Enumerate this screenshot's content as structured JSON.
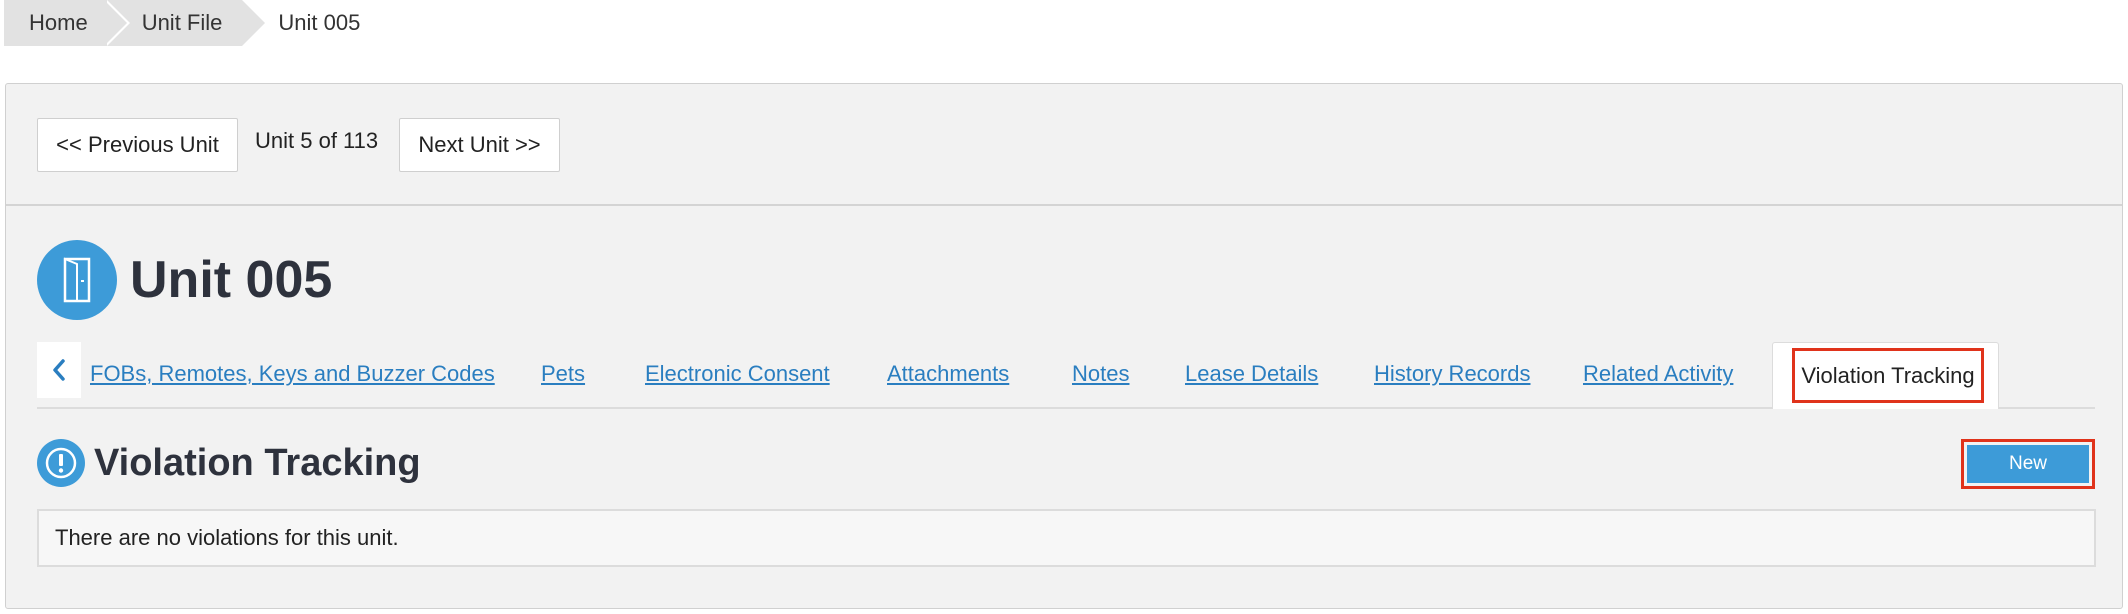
{
  "breadcrumb": {
    "home": "Home",
    "unit_file": "Unit File",
    "current": "Unit 005"
  },
  "pager": {
    "previous_label": "<< Previous Unit",
    "count_text": "Unit 5 of 113",
    "next_label": "Next Unit >>"
  },
  "unit": {
    "title": "Unit 005",
    "icon": "door-icon"
  },
  "tabs": {
    "scroll_icon": "chevron-left-icon",
    "items": [
      {
        "label": "FOBs, Remotes, Keys and Buzzer Codes"
      },
      {
        "label": "Pets"
      },
      {
        "label": "Electronic Consent"
      },
      {
        "label": "Attachments"
      },
      {
        "label": "Notes"
      },
      {
        "label": "Lease Details"
      },
      {
        "label": "History Records"
      },
      {
        "label": "Related Activity"
      },
      {
        "label": "Violation Tracking"
      }
    ],
    "active": "Violation Tracking"
  },
  "section": {
    "title": "Violation Tracking",
    "icon": "exclamation-icon",
    "new_label": "New",
    "empty_message": "There are no violations for this unit."
  },
  "colors": {
    "accent": "#3d9bd8",
    "link": "#2a7ec0",
    "highlight": "#e0331b",
    "panel_bg": "#f2f2f2"
  }
}
